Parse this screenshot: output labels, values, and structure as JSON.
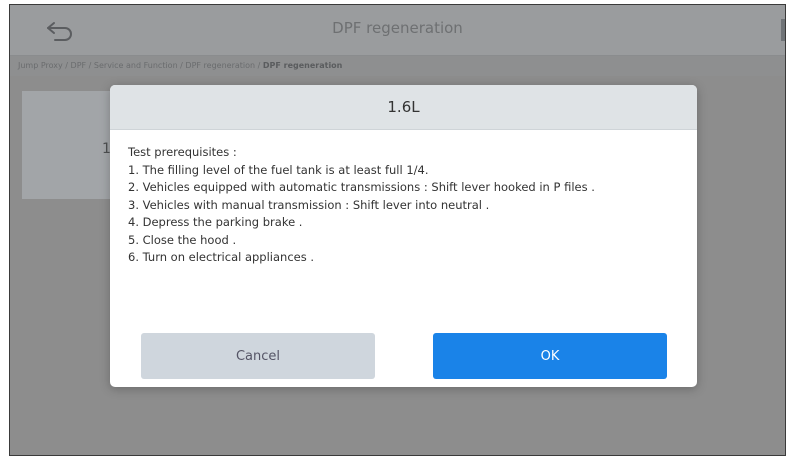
{
  "header": {
    "title": "DPF regeneration",
    "back_icon": "back-icon"
  },
  "breadcrumb": {
    "path": "Jump Proxy / DPF / Service and Function / DPF regeneration / ",
    "current": "DPF regeneration"
  },
  "background": {
    "item_number": "1."
  },
  "dialog": {
    "title": "1.6L",
    "intro": "Test prerequisites :",
    "items": [
      "1. The filling level of the fuel tank is at least full 1/4.",
      "2. Vehicles equipped with automatic transmissions : Shift lever hooked in P files .",
      "3. Vehicles with manual transmission : Shift lever into neutral .",
      "4. Depress the parking brake .",
      "5. Close the hood .",
      "6. Turn on electrical appliances ."
    ],
    "cancel_label": "Cancel",
    "ok_label": "OK"
  },
  "colors": {
    "accent": "#1a83e8",
    "overlay": "#8d8d8d",
    "dialog_header": "#dfe3e6",
    "cancel_button": "#cfd6dd"
  }
}
